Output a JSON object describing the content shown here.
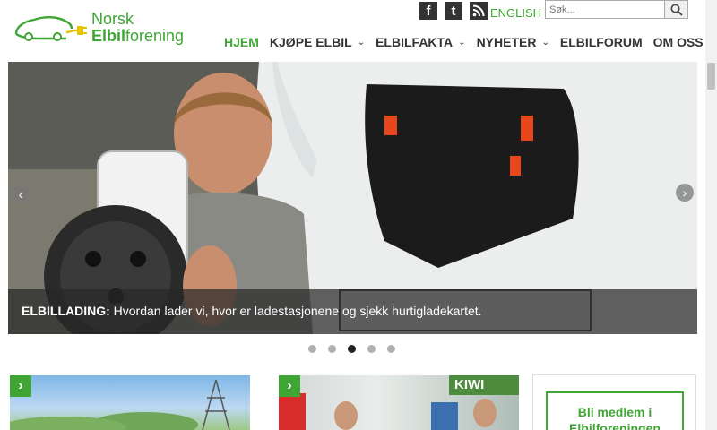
{
  "logo": {
    "line1": "Norsk",
    "line2_bold": "Elbil",
    "line2_rest": "forening"
  },
  "social": {
    "facebook": "f",
    "twitter": "t"
  },
  "language_link": "ENGLISH",
  "search": {
    "placeholder": "Søk..."
  },
  "nav": {
    "items": [
      {
        "label": "HJEM",
        "has_dropdown": false,
        "active": true
      },
      {
        "label": "KJØPE ELBIL",
        "has_dropdown": true
      },
      {
        "label": "ELBILFAKTA",
        "has_dropdown": true
      },
      {
        "label": "NYHETER",
        "has_dropdown": true
      },
      {
        "label": "ELBILFORUM",
        "has_dropdown": false
      },
      {
        "label": "OM OSS",
        "has_dropdown": true
      }
    ]
  },
  "hero": {
    "caption_bold": "ELBILLADING:",
    "caption_text": " Hvordan lader vi, hvor er ladestasjonene og sjekk hurtigladekartet.",
    "slide_count": 5,
    "active_slide": 3
  },
  "cards": {
    "card2_sign": "KIWI"
  },
  "member": {
    "line1": "Bli medlem i",
    "line2": "Elbilforeningen"
  },
  "colors": {
    "brand_green": "#3fa535",
    "dark": "#333333"
  }
}
